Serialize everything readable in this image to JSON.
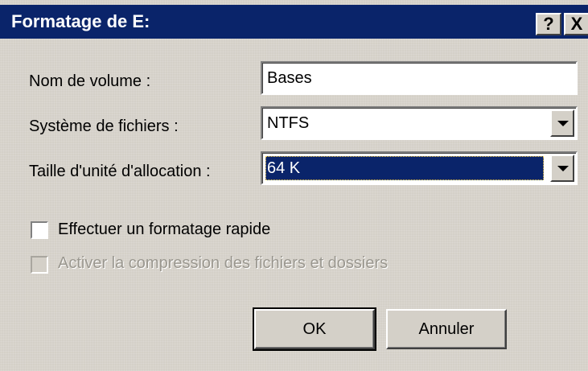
{
  "window": {
    "title": "Formatage de E:",
    "help_label": "?",
    "close_label": "X"
  },
  "fields": {
    "volume_name_label": "Nom de volume :",
    "volume_name_value": "Bases",
    "filesystem_label": "Système de fichiers :",
    "filesystem_value": "NTFS",
    "allocation_label": "Taille d'unité d'allocation :",
    "allocation_value": "64 K"
  },
  "options": {
    "quick_format_label": "Effectuer un formatage rapide",
    "quick_format_checked": false,
    "compression_label": "Activer la compression des fichiers et dossiers",
    "compression_checked": false,
    "compression_enabled": false
  },
  "buttons": {
    "ok_label": "OK",
    "cancel_label": "Annuler"
  },
  "colors": {
    "face": "#d4d0c8",
    "titlebar": "#0a246a",
    "selection": "#0a246a",
    "disabled_text": "#9a978f"
  },
  "icons": {
    "dropdown": "chevron-down-icon",
    "help": "help-icon",
    "close": "close-icon"
  }
}
